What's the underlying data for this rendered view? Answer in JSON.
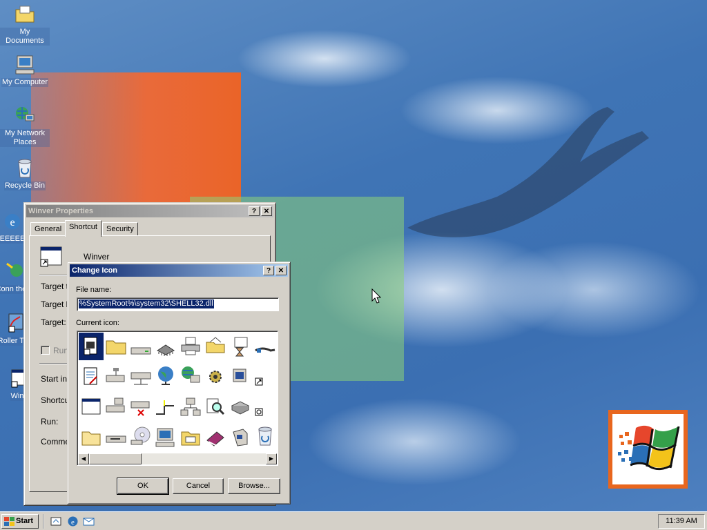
{
  "desktop": {
    "icons": [
      {
        "label": "My Documents",
        "icon": "folder-documents-icon"
      },
      {
        "label": "My Computer",
        "icon": "computer-icon"
      },
      {
        "label": "My Network Places",
        "icon": "network-icon"
      },
      {
        "label": "Recycle Bin",
        "icon": "recycle-bin-icon"
      },
      {
        "label": "EEEEE",
        "icon": "internet-explorer-icon"
      },
      {
        "label": "Conn the In",
        "icon": "connect-internet-icon"
      },
      {
        "label": "Roller Tyc",
        "icon": "rollercoaster-shortcut-icon"
      },
      {
        "label": "Win",
        "icon": "winver-shortcut-icon"
      }
    ]
  },
  "properties_dialog": {
    "title": "Winver Properties",
    "help": "?",
    "close": "✕",
    "tabs": [
      "General",
      "Shortcut",
      "Security"
    ],
    "app_name": "Winver",
    "fields": [
      "Target ty",
      "Target lo",
      "Target:"
    ],
    "run_checkbox": "Run",
    "fields2": [
      "Start in:",
      "Shortcu",
      "Run:",
      "Commen"
    ]
  },
  "change_icon_dialog": {
    "title": "Change Icon",
    "help": "?",
    "close": "✕",
    "file_name_label": "File name:",
    "file_name_value": "%SystemRoot%\\system32\\SHELL32.dll",
    "current_icon_label": "Current icon:",
    "ok_label": "OK",
    "cancel_label": "Cancel",
    "browse_label": "Browse..."
  },
  "taskbar": {
    "start_label": "Start",
    "clock": "11:39 AM"
  },
  "colors": {
    "title_active": "#0a246a",
    "title_inactive": "#808080",
    "face": "#d4d0c8",
    "selection": "#0a246a"
  }
}
